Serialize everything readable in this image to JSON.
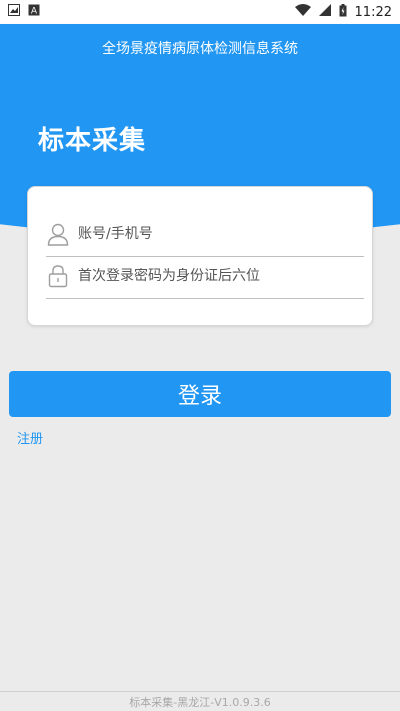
{
  "status_bar": {
    "time": "11:22"
  },
  "app_bar": {
    "title": "全场景疫情病原体检测信息系统"
  },
  "hero": {
    "title": "标本采集"
  },
  "login_form": {
    "account_placeholder": "账号/手机号",
    "password_placeholder": "首次登录密码为身份证后六位",
    "login_label": "登录",
    "register_label": "注册"
  },
  "footer": {
    "version_text": "标本采集-黑龙江-V1.0.9.3.6"
  },
  "colors": {
    "primary": "#2196f3",
    "background": "#ebebeb"
  },
  "icons": {
    "account": "user-icon",
    "password": "lock-icon"
  }
}
